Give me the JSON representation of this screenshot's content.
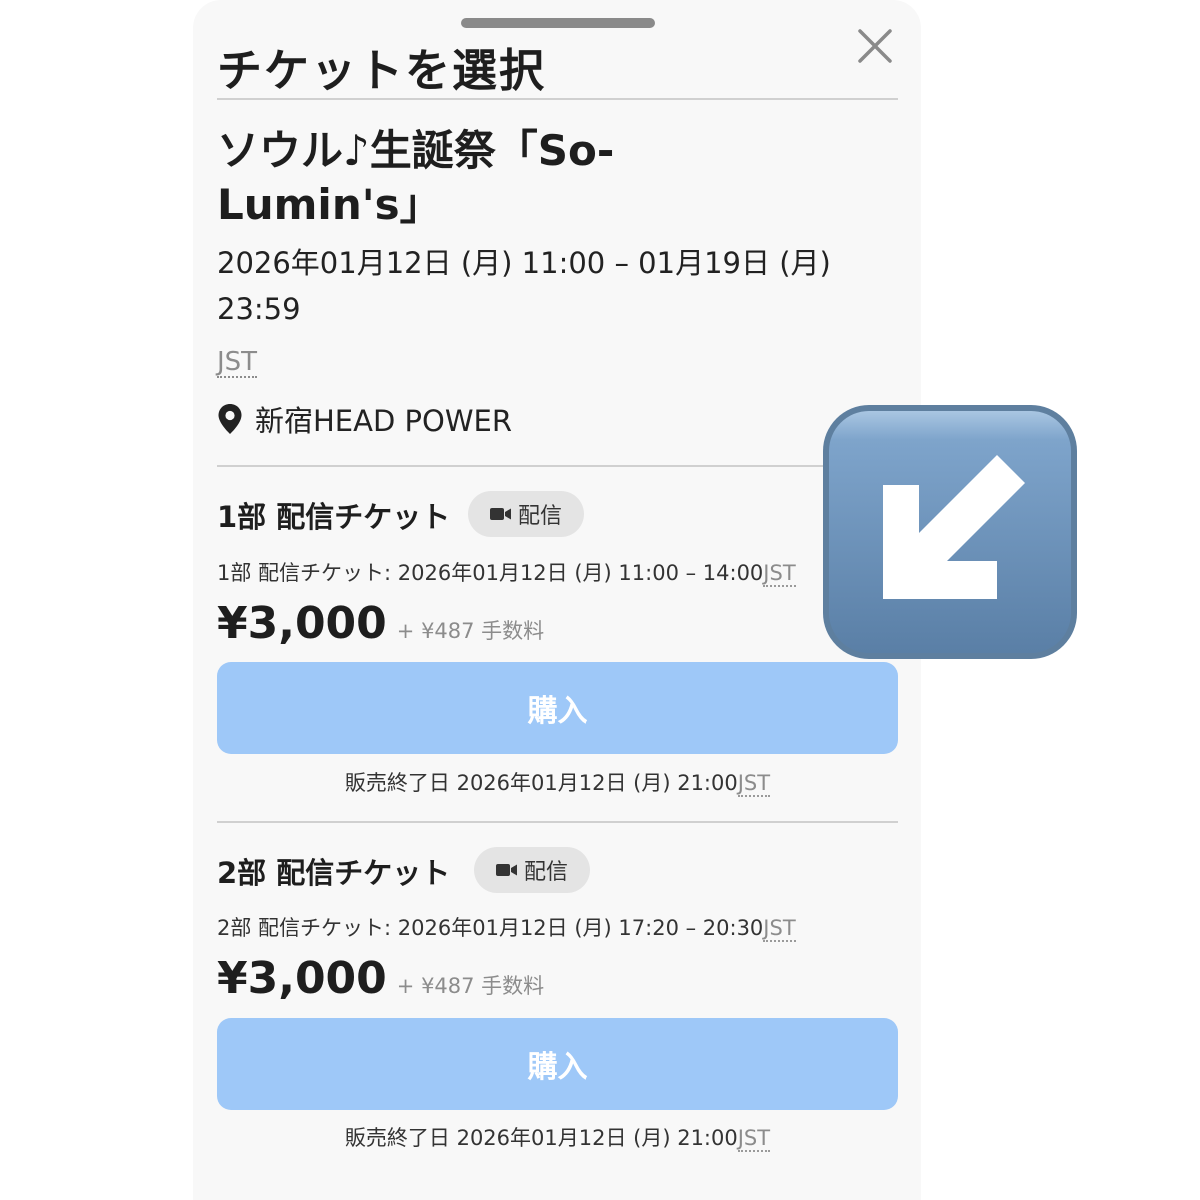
{
  "sheet": {
    "title": "チケットを選択",
    "close_icon": "close-icon"
  },
  "event": {
    "title": "ソウル♪生誕祭「So-Lumin's」",
    "dates": "2026年01月12日 (月) 11:00 – 01月19日 (月) 23:59",
    "timezone": "JST",
    "venue_icon": "location-pin-icon",
    "venue": "新宿HEAD POWER"
  },
  "tickets": [
    {
      "name": "1部 配信チケット",
      "badge_icon": "video-camera-icon",
      "badge": "配信",
      "detail": "1部 配信チケット: 2026年01月12日 (月) 11:00 – 14:00",
      "detail_tz": "JST",
      "price": "¥3,000",
      "fee": "+ ¥487 手数料",
      "buy_label": "購入",
      "sale_end": "販売終了日 2026年01月12日 (月) 21:00",
      "sale_end_tz": "JST"
    },
    {
      "name": "2部 配信チケット",
      "badge_icon": "video-camera-icon",
      "badge": "配信",
      "detail": "2部 配信チケット: 2026年01月12日 (月) 17:20 – 20:30",
      "detail_tz": "JST",
      "price": "¥3,000",
      "fee": "+ ¥487 手数料",
      "buy_label": "購入",
      "sale_end": "販売終了日 2026年01月12日 (月) 21:00",
      "sale_end_tz": "JST"
    }
  ],
  "overlay": {
    "icon": "down-left-arrow-emoji-icon"
  },
  "colors": {
    "sheet_background": "#f8f8f8",
    "buy_button": "#9ec8f8",
    "badge_background": "#e4e4e4",
    "emoji_blue": "#6e95bd"
  }
}
